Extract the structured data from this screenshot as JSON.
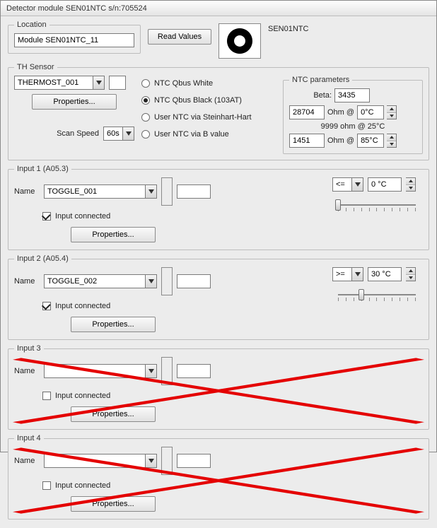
{
  "window": {
    "title": "Detector module SEN01NTC s/n:705524"
  },
  "header": {
    "module_label": "SEN01NTC",
    "location_group": "Location",
    "location_value": "Module SEN01NTC_11",
    "read_values_btn": "Read Values"
  },
  "th": {
    "legend": "TH Sensor",
    "sensor_select": "THERMOST_001",
    "properties_btn": "Properties...",
    "scan_speed_label": "Scan Speed",
    "scan_speed_value": "60s",
    "radios": {
      "r1": "NTC Qbus White",
      "r2": "NTC Qbus  Black (103AT)",
      "r3": "User NTC via Steinhart-Hart",
      "r4": "User NTC via B value",
      "selected": "r2"
    },
    "ntc_params": {
      "legend": "NTC parameters",
      "beta_label": "Beta:",
      "beta_value": "3435",
      "ohm_at_label": "Ohm @",
      "r1_value": "28704",
      "t1_value": "0°C",
      "line_static": "9999 ohm @ 25°C",
      "r2_value": "1451",
      "t2_value": "85°C"
    }
  },
  "inputs": [
    {
      "legend": "Input 1 (A05.3)",
      "name_label": "Name",
      "name_value": "TOGGLE_001",
      "connected_label": "Input connected",
      "connected": true,
      "properties_btn": "Properties...",
      "op": "<=",
      "temp": "0 °C",
      "thumb_pct": 0,
      "disabled": false
    },
    {
      "legend": "Input 2 (A05.4)",
      "name_label": "Name",
      "name_value": "TOGGLE_002",
      "connected_label": "Input connected",
      "connected": true,
      "properties_btn": "Properties...",
      "op": ">=",
      "temp": "30 °C",
      "thumb_pct": 30,
      "disabled": false
    },
    {
      "legend": "Input 3",
      "name_label": "Name",
      "name_value": "",
      "connected_label": "Input connected",
      "connected": false,
      "properties_btn": "Properties...",
      "op": "",
      "temp": "",
      "thumb_pct": 0,
      "disabled": true
    },
    {
      "legend": "Input 4",
      "name_label": "Name",
      "name_value": "",
      "connected_label": "Input connected",
      "connected": false,
      "properties_btn": "Properties...",
      "op": "",
      "temp": "",
      "thumb_pct": 0,
      "disabled": true
    }
  ]
}
